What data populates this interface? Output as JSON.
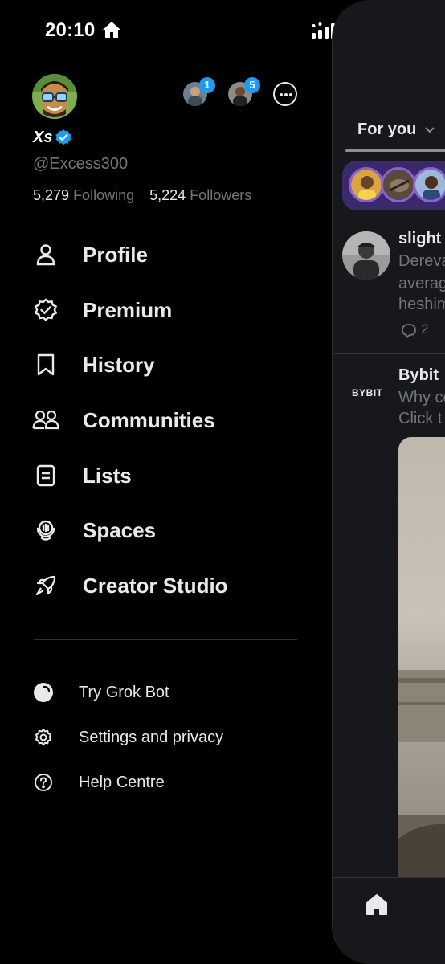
{
  "status_bar": {
    "time": "20:10"
  },
  "profile": {
    "display_name": "Xs",
    "handle": "@Excess300",
    "following_count": "5,279",
    "following_label": "Following",
    "followers_count": "5,224",
    "followers_label": "Followers",
    "verified": true
  },
  "accounts": [
    {
      "badge": "1"
    },
    {
      "badge": "5"
    }
  ],
  "menu": {
    "items": [
      {
        "label": "Profile",
        "icon": "person-icon"
      },
      {
        "label": "Premium",
        "icon": "verified-badge-icon"
      },
      {
        "label": "History",
        "icon": "bookmark-icon"
      },
      {
        "label": "Communities",
        "icon": "people-icon"
      },
      {
        "label": "Lists",
        "icon": "list-icon"
      },
      {
        "label": "Spaces",
        "icon": "spaces-icon"
      },
      {
        "label": "Creator Studio",
        "icon": "rocket-icon"
      }
    ]
  },
  "secondary": {
    "items": [
      {
        "label": "Try Grok Bot",
        "icon": "grok-icon"
      },
      {
        "label": "Settings and privacy",
        "icon": "gear-icon"
      },
      {
        "label": "Help Centre",
        "icon": "help-icon"
      }
    ]
  },
  "feed": {
    "tab_label": "For you",
    "post1": {
      "author": "slight",
      "lines": [
        "Dereva",
        "averag",
        "heshim"
      ],
      "reply_count": "2"
    },
    "post2": {
      "author": "Bybit",
      "logo_text": "BYBIT",
      "lines": [
        "Why co",
        "Click t"
      ]
    }
  },
  "colors": {
    "accent": "#1d9bf0",
    "background": "#000000",
    "text_primary": "#e7e9ea",
    "text_secondary": "#71767b",
    "spaces_bar": "#3a2a6b"
  }
}
